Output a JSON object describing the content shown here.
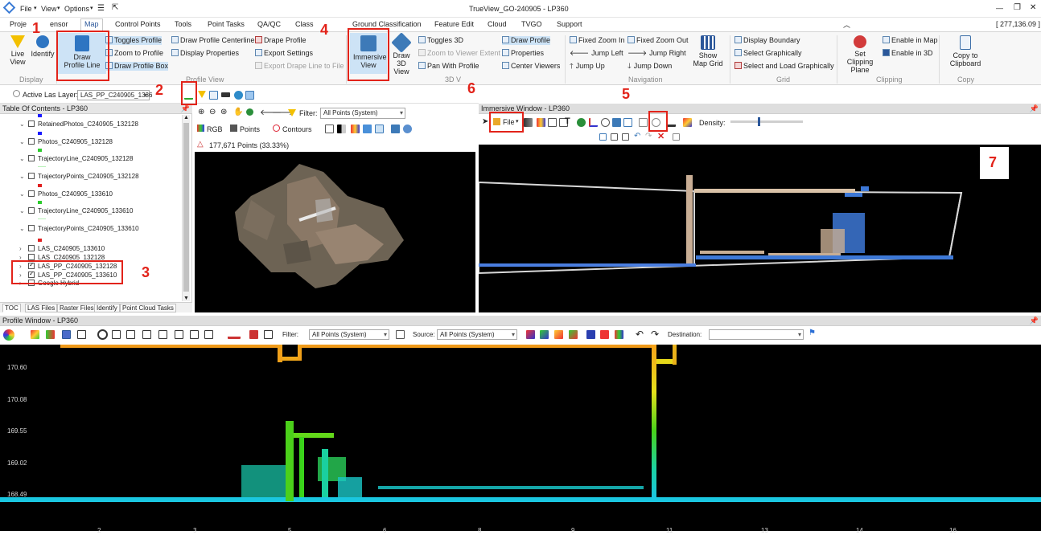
{
  "window": {
    "title": "TrueView_GO-240905 - LP360",
    "coords": "[ 277,136.09 ]",
    "menus": [
      "File",
      "View",
      "Options"
    ],
    "controls": {
      "minimize": "—",
      "restore": "❐",
      "close": "✕"
    }
  },
  "tabs": [
    "Proje",
    "ensor",
    "Map",
    "Control Points",
    "Tools",
    "Point Tasks",
    "QA/QC",
    "Class",
    "Ground Classification",
    "Feature Edit",
    "Cloud",
    "TVGO",
    "Support"
  ],
  "ribbon": {
    "display": {
      "live_view": "Live View",
      "identify": "Identify",
      "group": "Display"
    },
    "profile_view": {
      "draw_profile_line": "Draw Profile Line",
      "toggles_profile": "Toggles Profile",
      "zoom_to_profile": "Zoom to Profile",
      "draw_profile_box": "Draw Profile Box",
      "draw_profile_centerline": "Draw Profile Centerline",
      "display_properties": "Display Properties",
      "drape_profile": "Drape Profile",
      "export_settings": "Export Settings",
      "export_drape_line": "Export Drape Line to File",
      "group": "Profile View"
    },
    "view3d": {
      "immersive_view": "Immersive View",
      "draw_3d_view": "Draw 3D View",
      "toggles_3d": "Toggles 3D",
      "zoom_to_viewer_extent": "Zoom to Viewer Extent",
      "pan_with_profile": "Pan With Profile",
      "draw_profile": "Draw Profile",
      "properties": "Properties",
      "center_viewers": "Center Viewers",
      "group": "3D V"
    },
    "navigation": {
      "fixed_zoom_in": "Fixed Zoom In",
      "fixed_zoom_out": "Fixed Zoom Out",
      "jump_left": "Jump Left",
      "jump_right": "Jump Right",
      "jump_up": "Jump Up",
      "jump_down": "Jump Down",
      "show_map_grid": "Show Map Grid",
      "group": "Navigation"
    },
    "grid": {
      "display_boundary": "Display Boundary",
      "select_graphically": "Select Graphically",
      "select_and_load": "Select and Load Graphically",
      "group": "Grid"
    },
    "clipping": {
      "set_clipping_plane": "Set Clipping Plane",
      "enable_in_map": "Enable in Map",
      "enable_in_3d": "Enable in 3D",
      "group": "Clipping"
    },
    "copy": {
      "copy_to_clipboard": "Copy to Clipboard",
      "group": "Copy"
    }
  },
  "active_layer": {
    "label": "Active Las Layer:",
    "value": "LAS_PP_C240905_1336"
  },
  "toc": {
    "title": "Table Of Contents - LP360",
    "items": [
      {
        "label": "RetainedPhotos_C240905_132128",
        "checked": false,
        "legend": "#1a1aff"
      },
      {
        "label": "Photos_C240905_132128",
        "checked": false,
        "legend": "#1a1aff"
      },
      {
        "label": "TrajectoryLine_C240905_132128",
        "checked": false,
        "legend": "#2ecc2e"
      },
      {
        "label": "TrajectoryPoints_C240905_132128",
        "checked": false,
        "legend": "#b7f0b7"
      },
      {
        "label": "Photos_C240905_133610",
        "checked": false,
        "legend": "#e02020"
      },
      {
        "label": "TrajectoryLine_C240905_133610",
        "checked": false,
        "legend": "#2ecc2e"
      },
      {
        "label": "TrajectoryPoints_C240905_133610",
        "checked": false,
        "legend": "#b7f0b7"
      },
      {
        "label": "LAS_C240905_133610",
        "checked": false,
        "legend": "#e02020"
      },
      {
        "label": "LAS_C240905_132128",
        "checked": false,
        "legend": ""
      },
      {
        "label": "LAS_PP_C240905_132128",
        "checked": true,
        "legend": ""
      },
      {
        "label": "LAS_PP_C240905_133610",
        "checked": true,
        "legend": ""
      },
      {
        "label": "Google Hybrid",
        "checked": false,
        "legend": ""
      }
    ],
    "bottom_tabs": [
      "TOC",
      "LAS Files",
      "Raster Files",
      "Identify",
      "Point Cloud Tasks"
    ]
  },
  "mapview": {
    "filter_label": "Filter:",
    "filter_value": "All Points (System)",
    "rgb_label": "RGB",
    "points_label": "Points",
    "contours_label": "Contours",
    "point_count": "177,671 Points (33.33%)"
  },
  "immersive": {
    "title": "Immersive Window - LP360",
    "file_label": "File",
    "density_label": "Density:",
    "density_level": 0.38
  },
  "profile": {
    "title": "Profile Window - LP360",
    "filter_label": "Filter:",
    "filter_value": "All Points (System)",
    "source_label": "Source:",
    "source_value": "All Points (System)",
    "destination_label": "Destination:",
    "y_ticks": [
      "170.60",
      "170.08",
      "169.55",
      "169.02",
      "168.49"
    ],
    "x_ticks": [
      "2",
      "3",
      "5",
      "6",
      "8",
      "9",
      "11",
      "13",
      "14",
      "16"
    ]
  },
  "annotations": [
    "1",
    "2",
    "3",
    "4",
    "5",
    "6",
    "7"
  ]
}
